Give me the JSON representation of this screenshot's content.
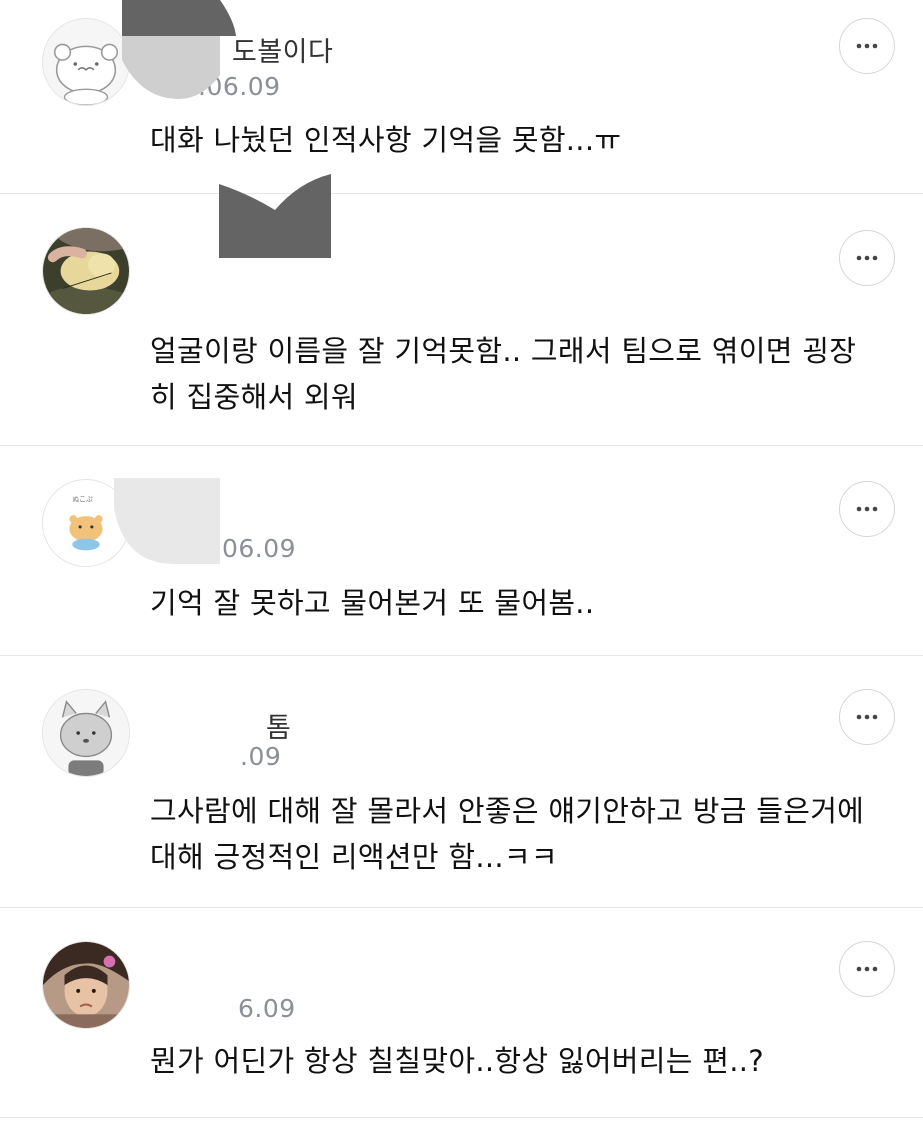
{
  "comments": [
    {
      "username": "도볼이다",
      "date": ".06.09",
      "text": "대화 나눴던 인적사항 기억을 못함...ㅠ",
      "avatar": "bear-face-avatar"
    },
    {
      "username": "",
      "date": "",
      "text": "얼굴이랑 이름을 잘 기억못함.. 그래서 팀으로 엮이면 굉장히 집중해서 외워",
      "avatar": "chick-photo-avatar"
    },
    {
      "username": "",
      "date": "06.09",
      "text": "기억 잘 못하고 물어본거 또 물어봄..",
      "avatar": "hamster-sticker-avatar"
    },
    {
      "username": "톰",
      "date": ".09",
      "text": "그사람에 대해 잘 몰라서 안좋은 얘기안하고 방금 들은거에 대해 긍정적인 리액션만 함...ㅋㅋ",
      "avatar": "gray-cat-avatar"
    },
    {
      "username": "",
      "date": "6.09",
      "text": "뭔가 어딘가 항상 칠칠맞아..항상 잃어버리는 편..?",
      "avatar": "child-photo-avatar"
    }
  ],
  "icons": {
    "more": "more-options-icon"
  },
  "colors": {
    "text": "#111111",
    "date": "#8a8f98",
    "divider": "#e6e6e6",
    "redaction": "#636363"
  }
}
